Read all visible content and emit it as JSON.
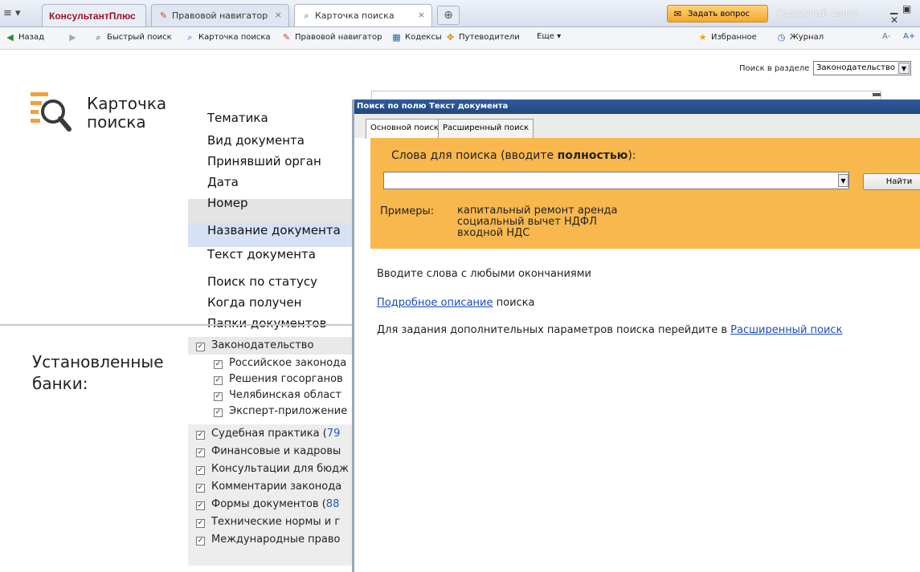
{
  "tabbar": {
    "menu": "≡ ▾",
    "brand": "КонсультантПлюс",
    "tabs": [
      {
        "label": "Правовой навигатор",
        "close": "×"
      },
      {
        "label": "Карточка поиска",
        "close": "×"
      }
    ],
    "add_tab": "⊕",
    "ask_button": "Задать вопрос",
    "service_center": "Сервисный центр",
    "window_controls": "▁ ▣ ✕"
  },
  "toolbar": {
    "back": "Назад",
    "quick_search": "Быстрый поиск",
    "search_card": "Карточка поиска",
    "legal_navigator": "Правовой навигатор",
    "codes": "Кодексы",
    "guides": "Путеводители",
    "more": "Еще ▾",
    "favorites": "Избранное",
    "journal": "Журнал",
    "font_smaller": "A-",
    "font_larger": "A+"
  },
  "section_search": {
    "label": "Поиск в разделе",
    "value": "Законодательство"
  },
  "card": {
    "title_line1": "Карточка",
    "title_line2": "поиска",
    "fields": [
      "Тематика",
      "Вид документа",
      "Принявший орган",
      "Дата",
      "Номер",
      "Название документа",
      "Текст документа",
      "Поиск по статусу",
      "Когда получен",
      "Папки документов"
    ]
  },
  "banks": {
    "title_line1": "Установленные",
    "title_line2": "банки:",
    "items": [
      {
        "label": "Законодательство",
        "num": ""
      },
      {
        "label": "Российское законода",
        "num": ""
      },
      {
        "label": "Решения госорганов",
        "num": ""
      },
      {
        "label": "Челябинская област",
        "num": ""
      },
      {
        "label": "Эксперт-приложение",
        "num": ""
      },
      {
        "label": "Судебная практика (",
        "num": "79"
      },
      {
        "label": "Финансовые и кадровы",
        "num": ""
      },
      {
        "label": "Консультации для бюдж",
        "num": ""
      },
      {
        "label": "Комментарии законода",
        "num": ""
      },
      {
        "label": "Формы документов (",
        "num": "88"
      },
      {
        "label": "Технические нормы и г",
        "num": ""
      },
      {
        "label": "Международные право",
        "num": ""
      }
    ]
  },
  "dialog": {
    "title": "Поиск по полю Текст документа",
    "tabs": [
      "Основной поиск",
      "Расширенный поиск"
    ],
    "words_label_prefix": "Слова для поиска (вводите ",
    "words_label_bold": "полностью",
    "words_label_suffix": "):",
    "search_input": "",
    "find_button": "Найти",
    "examples_label": "Примеры:",
    "examples": [
      "капитальный ремонт аренда",
      "социальный вычет НДФЛ",
      "входной НДС"
    ],
    "hint": "Вводите слова с любыми окончаниями",
    "details_link": "Подробное описание",
    "details_suffix": " поиска",
    "advanced_text": "Для задания дополнительных параметров поиска перейдите в ",
    "advanced_link": "Расширенный поиск"
  },
  "colors": {
    "brand": "#a0102a",
    "dialog_title": "#2f5c9e",
    "search_panel": "#f8b84e",
    "field_highlight_gray": "#e4e4e4",
    "field_highlight_blue": "#d6e1f6",
    "link": "#1a4cc0"
  }
}
